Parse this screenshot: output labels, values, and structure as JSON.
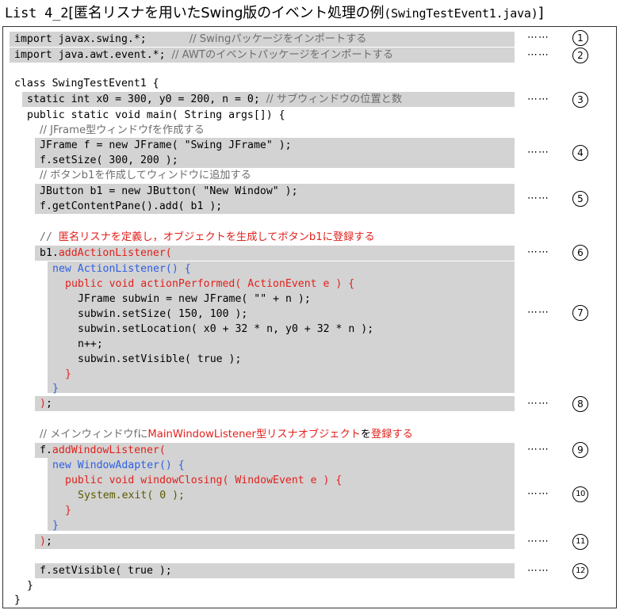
{
  "title": {
    "prefix": "List 4_2",
    "bracket_open": "[",
    "main": "匿名リスナを用いたSwing版のイベント処理の例",
    "file": "(SwingTestEvent1.java)",
    "bracket_close": "]"
  },
  "code": {
    "l1_code": "import javax.swing.*;",
    "l1_comment": "// Swingパッケージをインポートする",
    "l2_code": "import java.awt.event.*;",
    "l2_comment": "// AWTのイベントパッケージをインポートする",
    "l3": "class SwingTestEvent1 {",
    "l4_code": "static int x0 = 300, y0 = 200, n = 0;",
    "l4_comment": "// サブウィンドウの位置と数",
    "l5": "public static void main( String args[]) {",
    "l6": "// JFrame型ウィンドウfを作成する",
    "l7": "JFrame f = new JFrame( \"Swing JFrame\" );",
    "l8": "f.setSize( 300, 200 );",
    "l9": "// ボタンb1を作成してウィンドウに追加する",
    "l10": "JButton b1 = new JButton( \"New Window\" );",
    "l11": "f.getContentPane().add( b1 );",
    "l12_slash": "// ",
    "l12_text": "匿名リスナを定義し，オブジェクトを生成してボタンb1に登録する",
    "l13_obj": "b1.",
    "l13_method": "addActionListener(",
    "l14": "new ActionListener() {",
    "l15": "public void actionPerformed( ActionEvent e ) {",
    "l16": "JFrame subwin = new JFrame( \"\" + n );",
    "l17": "subwin.setSize( 150, 100 );",
    "l18": "subwin.setLocation( x0 + 32 * n, y0 + 32 * n );",
    "l19": "n++;",
    "l20": "subwin.setVisible( true );",
    "l21": "}",
    "l22": "}",
    "l23_paren": ")",
    "l23_semi": ";",
    "l24_a": "// メインウィンドウfに",
    "l24_b": "MainWindowListener型リスナオブジェクト",
    "l24_c": "を",
    "l24_d": "登録する",
    "l25_obj": "f.",
    "l25_method": "addWindowListener(",
    "l26": "new WindowAdapter() {",
    "l27": "public void windowClosing( WindowEvent e ) {",
    "l28": "System.exit( 0 );",
    "l29": "}",
    "l30": "}",
    "l31_paren": ")",
    "l31_semi": ";",
    "l32": "f.setVisible( true );",
    "l33": "}",
    "l34": "}"
  },
  "markers": {
    "dots": "⋯⋯",
    "n1": "1",
    "n2": "2",
    "n3": "3",
    "n4": "4",
    "n5": "5",
    "n6": "6",
    "n7": "7",
    "n8": "8",
    "n9": "9",
    "n10": "10",
    "n11": "11",
    "n12": "12"
  },
  "colors": {
    "highlight": "#d3d3d3",
    "comment": "#6e6e6e",
    "red": "#e1211c",
    "blue": "#2f5fe3"
  }
}
